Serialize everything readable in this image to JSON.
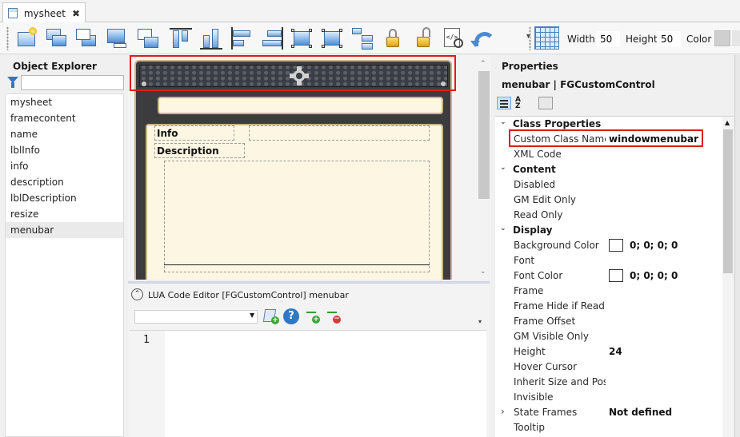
{
  "tab": {
    "label": "mysheet",
    "close": "✖"
  },
  "toolbar": {
    "width_label": "Width",
    "width_value": "50",
    "height_label": "Height",
    "height_value": "50",
    "color_label": "Color",
    "color_value": "#cfcfcf",
    "overflow": "▾"
  },
  "explorer": {
    "title": "Object Explorer",
    "filter_value": "",
    "items": [
      {
        "label": "mysheet"
      },
      {
        "label": "framecontent"
      },
      {
        "label": "name"
      },
      {
        "label": "lblInfo"
      },
      {
        "label": "info"
      },
      {
        "label": "description"
      },
      {
        "label": "lblDescription"
      },
      {
        "label": "resize"
      },
      {
        "label": "menubar",
        "selected": true
      }
    ]
  },
  "sheet": {
    "info_label": "Info",
    "description_label": "Description"
  },
  "canvas_scroll": {
    "up": "⌃",
    "down": "⌄"
  },
  "lua": {
    "collapse": "⌃",
    "title": "LUA Code Editor [FGCustomControl] menubar",
    "select_value": "",
    "help": "?",
    "line_number": "1"
  },
  "properties": {
    "title": "Properties",
    "subtitle": "menubar | FGCustomControl",
    "rows": [
      {
        "type": "category",
        "label": "Class Properties",
        "chevron": "⌄"
      },
      {
        "type": "prop",
        "name": "Custom Class Name",
        "value": "windowmenubar"
      },
      {
        "type": "prop",
        "name": "XML Code",
        "value": ""
      },
      {
        "type": "category",
        "label": "Content",
        "chevron": "⌄"
      },
      {
        "type": "prop",
        "name": "Disabled",
        "value": ""
      },
      {
        "type": "prop",
        "name": "GM Edit Only",
        "value": ""
      },
      {
        "type": "prop",
        "name": "Read Only",
        "value": ""
      },
      {
        "type": "category",
        "label": "Display",
        "chevron": "⌄"
      },
      {
        "type": "prop",
        "name": "Background Color",
        "value": "0; 0; 0; 0",
        "swatch": true
      },
      {
        "type": "prop",
        "name": "Font",
        "value": ""
      },
      {
        "type": "prop",
        "name": "Font Color",
        "value": "0; 0; 0; 0",
        "swatch": true
      },
      {
        "type": "prop",
        "name": "Frame",
        "value": ""
      },
      {
        "type": "prop",
        "name": "Frame Hide if Read Only",
        "value": ""
      },
      {
        "type": "prop",
        "name": "Frame Offset",
        "value": ""
      },
      {
        "type": "prop",
        "name": "GM Visible Only",
        "value": ""
      },
      {
        "type": "prop",
        "name": "Height",
        "value": "24"
      },
      {
        "type": "prop",
        "name": "Hover Cursor",
        "value": ""
      },
      {
        "type": "prop",
        "name": "Inherit Size and Position",
        "value": ""
      },
      {
        "type": "prop",
        "name": "Invisible",
        "value": ""
      },
      {
        "type": "category-collapsed",
        "name": "State Frames",
        "value": "Not defined",
        "chevron": "›"
      },
      {
        "type": "prop",
        "name": "Tooltip",
        "value": ""
      }
    ],
    "scroll_up": "▲"
  },
  "colors": {
    "selection_red": "#e01b1b",
    "accent_blue": "#2f78c5",
    "sheet_gold": "#c9b48a"
  }
}
